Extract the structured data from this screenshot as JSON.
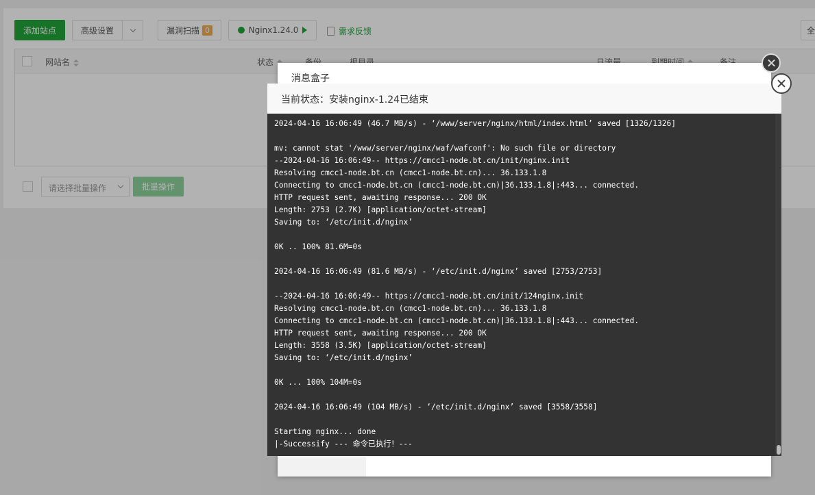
{
  "toolbar": {
    "add_site": "添加站点",
    "advanced": "高级设置",
    "vuln_scan": "漏洞扫描",
    "vuln_count": "0",
    "nginx_label": "Nginx1.24.0",
    "feedback": "需求反馈",
    "right_btn": "全"
  },
  "table": {
    "headers": {
      "site_name": "网站名",
      "status": "状态",
      "backup": "备份",
      "root_dir": "根目录",
      "traffic": "日流量",
      "expire": "到期时间",
      "remark": "备注"
    }
  },
  "batch": {
    "placeholder": "请选择批量操作",
    "button": "批量操作"
  },
  "msgbox": {
    "title": "消息盒子"
  },
  "dialog": {
    "status_title": "当前状态：安装nginx-1.24已结束",
    "log_lines": [
      "2024-04-16 16:06:49 (46.7 MB/s) - ‘/www/server/nginx/html/index.html’ saved [1326/1326]",
      "",
      "mv: cannot stat '/www/server/nginx/waf/wafconf': No such file or directory",
      "--2024-04-16 16:06:49-- https://cmcc1-node.bt.cn/init/nginx.init",
      "Resolving cmcc1-node.bt.cn (cmcc1-node.bt.cn)... 36.133.1.8",
      "Connecting to cmcc1-node.bt.cn (cmcc1-node.bt.cn)|36.133.1.8|:443... connected.",
      "HTTP request sent, awaiting response... 200 OK",
      "Length: 2753 (2.7K) [application/octet-stream]",
      "Saving to: ‘/etc/init.d/nginx’",
      "",
      "0K .. 100% 81.6M=0s",
      "",
      "2024-04-16 16:06:49 (81.6 MB/s) - ‘/etc/init.d/nginx’ saved [2753/2753]",
      "",
      "--2024-04-16 16:06:49-- https://cmcc1-node.bt.cn/init/124nginx.init",
      "Resolving cmcc1-node.bt.cn (cmcc1-node.bt.cn)... 36.133.1.8",
      "Connecting to cmcc1-node.bt.cn (cmcc1-node.bt.cn)|36.133.1.8|:443... connected.",
      "HTTP request sent, awaiting response... 200 OK",
      "Length: 3558 (3.5K) [application/octet-stream]",
      "Saving to: ‘/etc/init.d/nginx’",
      "",
      "0K ... 100% 104M=0s",
      "",
      "2024-04-16 16:06:49 (104 MB/s) - ‘/etc/init.d/nginx’ saved [3558/3558]",
      "",
      "Starting nginx... done",
      "|-Successify --- 命令已执行！---"
    ]
  }
}
